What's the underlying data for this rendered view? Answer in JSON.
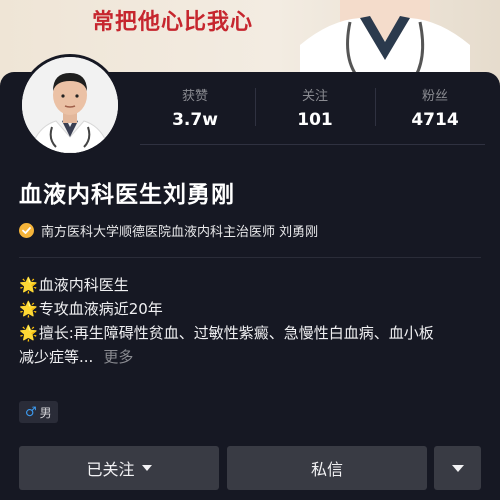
{
  "banner": {
    "slogan": "常把他心比我心",
    "doctor_icon": "doctor-illustration"
  },
  "profile": {
    "avatar_icon": "doctor-avatar",
    "name": "血液内科医生刘勇刚",
    "verified_icon": "check-badge-icon",
    "verified_text": "南方医科大学顺德医院血液内科主治医师 刘勇刚",
    "gender": "男",
    "gender_icon": "male-icon"
  },
  "stats": [
    {
      "label": "获赞",
      "value": "3.7w"
    },
    {
      "label": "关注",
      "value": "101"
    },
    {
      "label": "粉丝",
      "value": "4714"
    }
  ],
  "bio": {
    "star_icon": "🌟",
    "line1": "血液内科医生",
    "line2": "专攻血液病近20年",
    "line3": "擅长:再生障碍性贫血、过敏性紫癜、急慢性白血病、血小板",
    "line4": "减少症等...",
    "more": "更多"
  },
  "actions": {
    "follow_label": "已关注",
    "message_label": "私信"
  },
  "colors": {
    "background": "#161823",
    "button": "#393b44",
    "slogan": "#c6262e",
    "verified": "#f5b43a",
    "muted": "#8a8b91"
  }
}
